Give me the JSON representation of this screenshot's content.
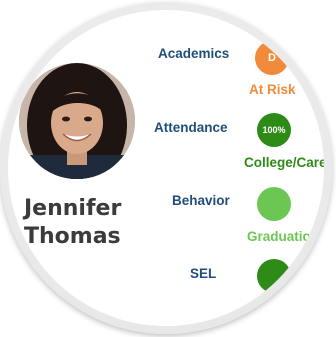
{
  "student": {
    "first_name": "Jennifer",
    "last_name": "Thomas"
  },
  "metrics": [
    {
      "label": "Academics",
      "badge": "D",
      "status": "At Risk",
      "color": "#f28a3c",
      "status_color": "#f28a3c"
    },
    {
      "label": "Attendance",
      "badge": "100%",
      "status": "College/Care",
      "color": "#2e8b17",
      "status_color": "#2e8b17"
    },
    {
      "label": "Behavior",
      "badge": "",
      "status": "Graduation",
      "color": "#6cc653",
      "status_color": "#6cc653"
    },
    {
      "label": "SEL",
      "badge": "",
      "status": "",
      "color": "#2e8b17",
      "status_color": "#2e8b17"
    }
  ]
}
